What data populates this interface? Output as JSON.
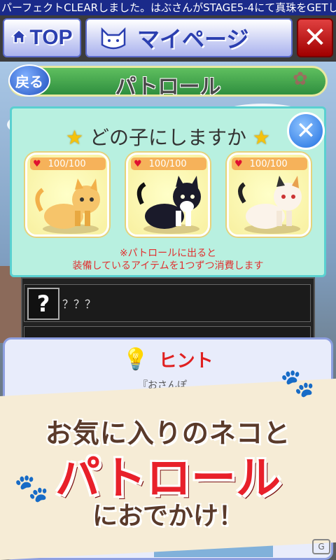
{
  "ticker": {
    "text": "パーフェクトCLEARしました。はぶさんがSTAGE5-4にて真珠をGETしま"
  },
  "topbar": {
    "top_label": "TOP",
    "mypage_label": "マイページ",
    "close_glyph": "✕"
  },
  "patrol": {
    "back_label": "戻る",
    "title": "パトロール"
  },
  "dialog": {
    "title": "どの子にしますか",
    "close_glyph": "✕",
    "cats": [
      {
        "name": "orange-tabby",
        "hp": "100/100",
        "hp_value": 100,
        "hp_max": 100
      },
      {
        "name": "tuxedo",
        "hp": "100/100",
        "hp_value": 100,
        "hp_max": 100
      },
      {
        "name": "calico",
        "hp": "100/100",
        "hp_value": 100,
        "hp_max": 100
      }
    ],
    "note_line1": "※パトロールに出ると",
    "note_line2": "装備しているアイテムを1つずつ消費します"
  },
  "list": {
    "unknown_label": "？？？",
    "q_glyph": "?"
  },
  "hint": {
    "title": "ヒント",
    "body": "『おさんぽ"
  },
  "banner": {
    "line1": "お気に入りのネコと",
    "line2": "パトロール",
    "line3": "におでかけ！"
  },
  "colors": {
    "accent_red": "#e8202a",
    "brand_blue": "#2b3fb0",
    "dialog_bg": "#b8f0e0",
    "hp_orange": "#f6b25a"
  }
}
